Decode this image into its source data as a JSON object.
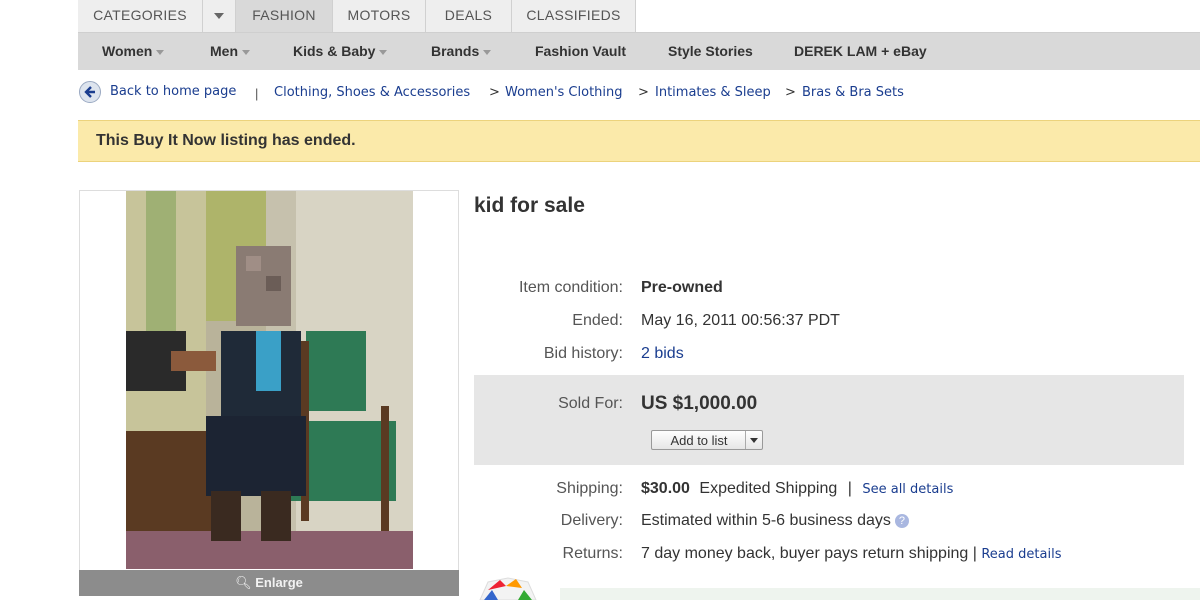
{
  "tabs": [
    {
      "label": "CATEGORIES"
    },
    {
      "label": ""
    },
    {
      "label": "FASHION"
    },
    {
      "label": "MOTORS"
    },
    {
      "label": "DEALS"
    },
    {
      "label": "CLASSIFIEDS"
    }
  ],
  "categories": [
    {
      "label": "Women"
    },
    {
      "label": "Men"
    },
    {
      "label": "Kids & Baby"
    },
    {
      "label": "Brands"
    },
    {
      "label": "Fashion Vault"
    },
    {
      "label": "Style Stories"
    },
    {
      "label": "DEREK LAM + eBay"
    }
  ],
  "breadcrumb": {
    "back": "Back to home page",
    "separator": "|",
    "items": [
      "Clothing, Shoes & Accessories",
      "Women's Clothing",
      "Intimates & Sleep",
      "Bras & Bra Sets"
    ],
    "arrow": ">"
  },
  "banner": {
    "text": "This Buy It Now listing has ended."
  },
  "image": {
    "enlarge": "Enlarge"
  },
  "item": {
    "title": "kid for sale",
    "condition_label": "Item condition:",
    "condition_value": "Pre-owned",
    "ended_label": "Ended:",
    "ended_value": "May 16, 2011 00:56:37 PDT",
    "bid_label": "Bid history:",
    "bid_value": "2 bids",
    "sold_label": "Sold For:",
    "sold_value": "US $1,000.00",
    "add_to_list": "Add to list",
    "shipping_label": "Shipping:",
    "shipping_price": "$30.00",
    "shipping_method": "Expedited Shipping",
    "shipping_sep": "|",
    "shipping_link": "See all details",
    "delivery_label": "Delivery:",
    "delivery_value": "Estimated within 5-6 business days",
    "returns_label": "Returns:",
    "returns_value": "7 day money back, buyer pays return shipping |",
    "returns_link": "Read details"
  },
  "colors": {
    "banner": "#fbeaaa",
    "link": "#1a3d8f",
    "nav": "#d9d9d9"
  }
}
